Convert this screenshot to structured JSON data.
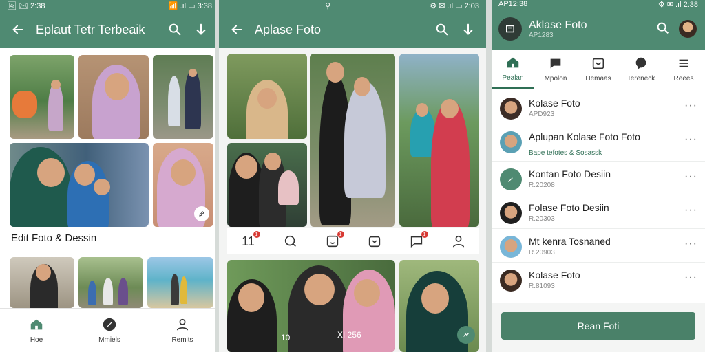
{
  "colors": {
    "brand_green": "#4f8a72",
    "accent_dark_green": "#2f6f55",
    "badge_red": "#d83a34"
  },
  "screen1": {
    "status": {
      "left": "🖼 ✉ 2:38",
      "right": "📶 .ıl ▭ 3:38"
    },
    "title": "Eplaut Tetr Terbeaik",
    "section_label": "Edit Foto & Dessin",
    "nav": [
      {
        "label": "Hoe",
        "icon": "home-icon"
      },
      {
        "label": "Mmiels",
        "icon": "edit-icon"
      },
      {
        "label": "Remits",
        "icon": "profile-icon"
      }
    ]
  },
  "screen2": {
    "status": {
      "center": "⚲",
      "right": "⚙ ✉ .ıl ▭ 2:03"
    },
    "title": "Aplase Foto",
    "badge_counts": [
      "1",
      "1",
      "1"
    ],
    "counter_label": "11",
    "photo_caption_left": "10",
    "photo_caption_right": "XI 256"
  },
  "screen3": {
    "status": {
      "left": "AP12:38",
      "right": "⚙ ✉ .ıl 2:38"
    },
    "title": "Aklase Foto",
    "subtitle": "AP1283",
    "tabs": [
      {
        "label": "Pealan",
        "icon": "home-icon",
        "active": true
      },
      {
        "label": "Mpolon",
        "icon": "chat-bubble-icon",
        "active": false
      },
      {
        "label": "Hemaas",
        "icon": "inbox-icon",
        "active": false
      },
      {
        "label": "Tereneck",
        "icon": "comment-icon",
        "active": false
      },
      {
        "label": "Reees",
        "icon": "menu-icon",
        "active": false
      }
    ],
    "list": [
      {
        "name": "Kolase Foto",
        "sub": "APD923"
      },
      {
        "name": "Aplupan Kolase Foto Foto",
        "sub": "Bape tefotes & Sosassk"
      },
      {
        "name": "Kontan Foto Desiin",
        "sub": "R.20208"
      },
      {
        "name": "Folase Foto Desiin",
        "sub": "R.20303"
      },
      {
        "name": "Mt kenra Tosnaned",
        "sub": "R.20903"
      },
      {
        "name": "Kolase Foto",
        "sub": "R.81093"
      }
    ],
    "more_glyph": "···",
    "cta_label": "Rean Foti"
  }
}
